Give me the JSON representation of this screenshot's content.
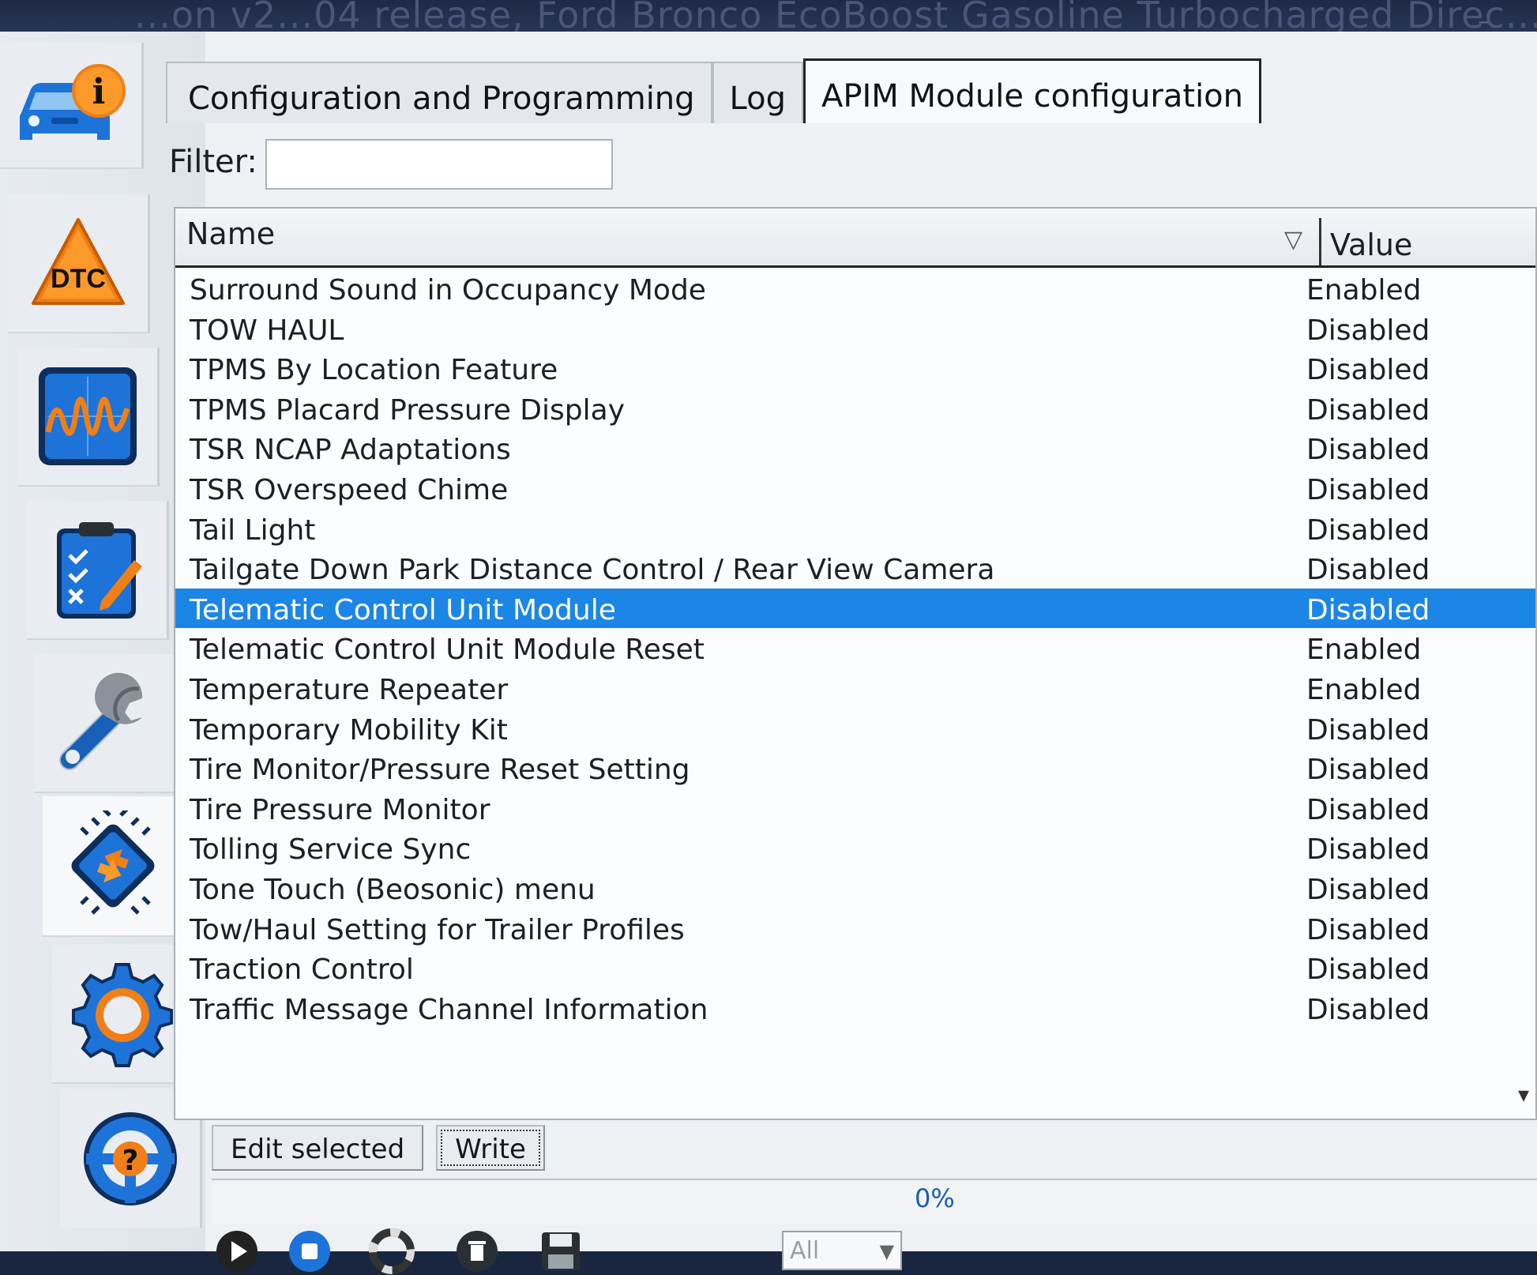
{
  "window": {
    "title": "...on v2...04 release, Ford Bronco EcoBoost Gasoline Turbocharged Direc..."
  },
  "tabs": [
    {
      "label": "Configuration and Programming",
      "active": false
    },
    {
      "label": "Log",
      "active": false
    },
    {
      "label": "APIM Module configuration",
      "active": true
    }
  ],
  "filter": {
    "label": "Filter:",
    "value": ""
  },
  "table": {
    "columns": {
      "name": "Name",
      "value": "Value"
    },
    "rows": [
      {
        "name": "Surround Sound in Occupancy Mode",
        "value": "Enabled"
      },
      {
        "name": "TOW HAUL",
        "value": "Disabled"
      },
      {
        "name": "TPMS By Location Feature",
        "value": "Disabled"
      },
      {
        "name": "TPMS Placard Pressure Display",
        "value": "Disabled"
      },
      {
        "name": "TSR NCAP Adaptations",
        "value": "Disabled"
      },
      {
        "name": "TSR Overspeed Chime",
        "value": "Disabled"
      },
      {
        "name": "Tail Light",
        "value": "Disabled"
      },
      {
        "name": "Tailgate Down Park Distance Control / Rear View Camera",
        "value": "Disabled"
      },
      {
        "name": "Telematic Control Unit Module",
        "value": "Disabled",
        "selected": true
      },
      {
        "name": "Telematic Control Unit Module Reset",
        "value": "Enabled"
      },
      {
        "name": "Temperature Repeater",
        "value": "Enabled"
      },
      {
        "name": "Temporary Mobility Kit",
        "value": "Disabled"
      },
      {
        "name": "Tire Monitor/Pressure Reset Setting",
        "value": "Disabled"
      },
      {
        "name": "Tire Pressure Monitor",
        "value": "Disabled"
      },
      {
        "name": "Tolling Service Sync",
        "value": "Disabled"
      },
      {
        "name": "Tone Touch (Beosonic) menu",
        "value": "Disabled"
      },
      {
        "name": "Tow/Haul Setting for Trailer Profiles",
        "value": "Disabled"
      },
      {
        "name": "Traction Control",
        "value": "Disabled"
      },
      {
        "name": "Traffic Message Channel Information",
        "value": "Disabled"
      }
    ]
  },
  "actions": {
    "edit_label": "Edit selected",
    "write_label": "Write"
  },
  "progress": {
    "text": "0%",
    "value": 0
  },
  "bottombar": {
    "log_level": "All"
  },
  "sidebar": {
    "dtc_label": "DTC",
    "info_label": "i",
    "help_label": "?"
  },
  "colors": {
    "selection": "#1c86e6",
    "accent_orange": "#f07f18",
    "accent_blue": "#1e73d8"
  }
}
